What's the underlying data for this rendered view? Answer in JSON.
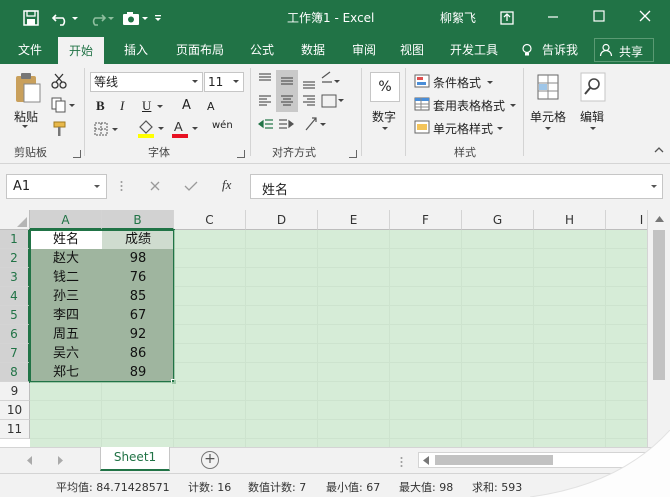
{
  "titlebar": {
    "title": "工作簿1  -  Excel",
    "user": "柳絮飞"
  },
  "tabs": [
    "文件",
    "开始",
    "插入",
    "页面布局",
    "公式",
    "数据",
    "审阅",
    "视图",
    "开发工具"
  ],
  "tell_me": "告诉我",
  "share": "共享",
  "ribbon": {
    "paste_label": "粘贴",
    "clipboard_label": "剪贴板",
    "font_name": "等线",
    "font_size": "11",
    "bold": "B",
    "italic": "I",
    "underline": "U",
    "grow_font": "A",
    "shrink_font": "A",
    "wen": "wén",
    "font_group_label": "字体",
    "align_group_label": "对齐方式",
    "number_label": "数字",
    "percent": "%",
    "cond_format": "条件格式",
    "table_format": "套用表格格式",
    "cell_style": "单元格样式",
    "styles_label": "样式",
    "cells_label": "单元格",
    "edit_label": "编辑"
  },
  "formula_bar": {
    "name_box": "A1",
    "fx": "fx",
    "content": "姓名"
  },
  "grid": {
    "columns": [
      "A",
      "B",
      "C",
      "D",
      "E",
      "F",
      "G",
      "H",
      "I"
    ],
    "rows": [
      "1",
      "2",
      "3",
      "4",
      "5",
      "6",
      "7",
      "8",
      "9",
      "10",
      "11"
    ],
    "data": [
      [
        "姓名",
        "成绩"
      ],
      [
        "赵大",
        "98"
      ],
      [
        "钱二",
        "76"
      ],
      [
        "孙三",
        "85"
      ],
      [
        "李四",
        "67"
      ],
      [
        "周五",
        "92"
      ],
      [
        "吴六",
        "86"
      ],
      [
        "郑七",
        "89"
      ]
    ]
  },
  "sheet": {
    "name": "Sheet1",
    "add": "+"
  },
  "status": {
    "average": "平均值: 84.71428571",
    "count": "计数: 16",
    "numcount": "数值计数: 7",
    "min": "最小值: 67",
    "max": "最大值: 98",
    "sum": "求和: 593"
  },
  "colors": {
    "excel_green": "#217346",
    "overlay_green": "#c8e6c9",
    "selection_fill": "#9fb59f"
  }
}
